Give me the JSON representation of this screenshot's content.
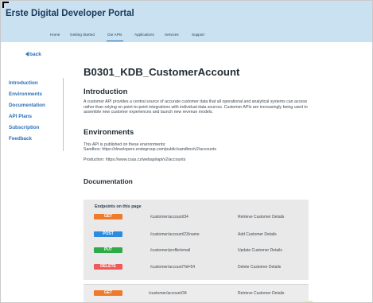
{
  "header": {
    "brand": "Erste Digital Developer Portal",
    "nav": [
      "Home",
      "Getting Started",
      "Our APIs",
      "Applications",
      "Services",
      "Support"
    ],
    "active_nav": "Our APIs"
  },
  "back_label": "back",
  "sidebar": {
    "items": [
      "Introduction",
      "Environments",
      "Documentation",
      "API Plans",
      "Subscription",
      "Feedback"
    ]
  },
  "main": {
    "title": "B0301_KDB_CustomerAccount",
    "introduction": {
      "heading": "Introduction",
      "text": "A customer API provides a central source of accurate customer data that all operational and analytical systems can access rather than relying on point-to-point integrations with individual data sources. Customer APIs are increasingly being used to assemble new customer experiences and launch new revenue models."
    },
    "environments": {
      "heading": "Environments",
      "line1": "This API is published on these environments:",
      "line2": "Sandbox: https://developers.erstegroup.com/public/sandbox/v2/accounts",
      "line3": "Production: https://www.csas.cz/webapi/api/v2/accounts"
    },
    "documentation": {
      "heading": "Documentation",
      "panel_title": "Endpoints on this page",
      "endpoints": [
        {
          "method": "GET",
          "path": "/customer/account/34",
          "desc": "Retrieve Customer Details",
          "color": "#f07a2c"
        },
        {
          "method": "POST",
          "path": "/customer/account/23/name",
          "desc": "Add Customer Details",
          "color": "#2c8ae0"
        },
        {
          "method": "PUT",
          "path": "/customer/profile/email",
          "desc": "Update Customer Details",
          "color": "#2eaa48"
        },
        {
          "method": "DELETE",
          "path": "/customer/account?id=54",
          "desc": "Delete Customer Details",
          "color": "#ee5a5a"
        }
      ],
      "detail": {
        "method": "GET",
        "path": "/customer/account/34",
        "desc": "Retrieve Customer Details",
        "color": "#f07a2c"
      }
    }
  }
}
